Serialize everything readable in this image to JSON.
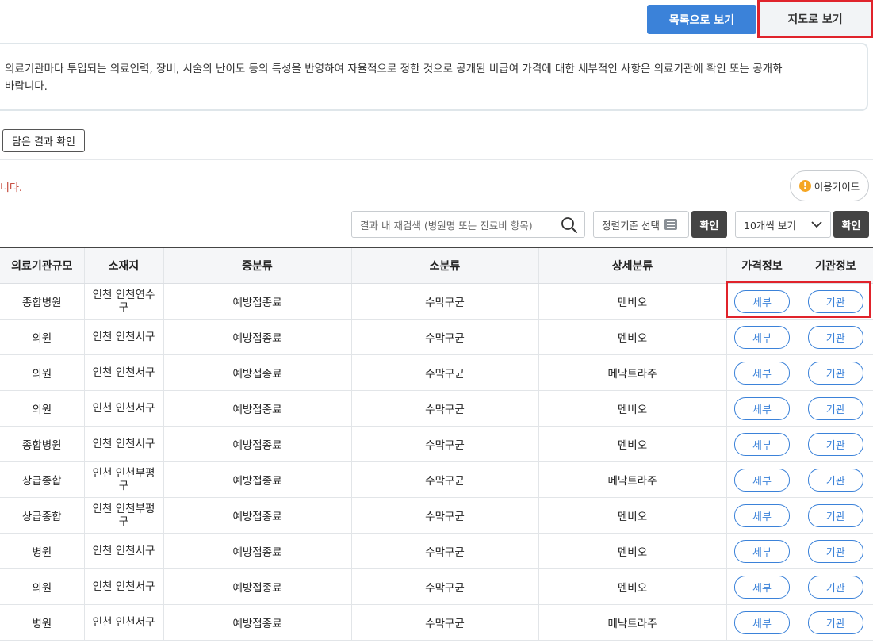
{
  "view_toggle": {
    "list_label": "목록으로 보기",
    "map_label": "지도로 보기"
  },
  "notice": {
    "line1": "의료기관마다 투입되는 의료인력, 장비, 시술의 난이도 등의 특성을 반영하여 자율적으로 정한 것으로 공개된 비급여 가격에 대한 세부적인 사항은 의료기관에 확인 또는 공개화",
    "line2": "바랍니다."
  },
  "cart_button": "담은 결과 확인",
  "red_note": "니다.",
  "guide_button": {
    "icon": "!",
    "label": "이용가이드"
  },
  "search": {
    "placeholder": "결과 내 재검색 (병원명 또는 진료비 항목)",
    "value": ""
  },
  "sort": {
    "label": "정렬기준 선택",
    "confirm": "확인"
  },
  "per_page": {
    "label": "10개씩 보기",
    "confirm": "확인"
  },
  "table": {
    "headers": [
      "의료기관규모",
      "소재지",
      "중분류",
      "소분류",
      "상세분류",
      "가격정보",
      "기관정보"
    ],
    "detail_label": "세부",
    "inst_label": "기관",
    "rows": [
      {
        "size": "종합병원",
        "loc": "인천 인천연수구",
        "mid": "예방접종료",
        "sub": "수막구균",
        "detail": "멘비오"
      },
      {
        "size": "의원",
        "loc": "인천 인천서구",
        "mid": "예방접종료",
        "sub": "수막구균",
        "detail": "멘비오"
      },
      {
        "size": "의원",
        "loc": "인천 인천서구",
        "mid": "예방접종료",
        "sub": "수막구균",
        "detail": "메낙트라주"
      },
      {
        "size": "의원",
        "loc": "인천 인천서구",
        "mid": "예방접종료",
        "sub": "수막구균",
        "detail": "멘비오"
      },
      {
        "size": "종합병원",
        "loc": "인천 인천서구",
        "mid": "예방접종료",
        "sub": "수막구균",
        "detail": "멘비오"
      },
      {
        "size": "상급종합",
        "loc": "인천 인천부평구",
        "mid": "예방접종료",
        "sub": "수막구균",
        "detail": "메낙트라주"
      },
      {
        "size": "상급종합",
        "loc": "인천 인천부평구",
        "mid": "예방접종료",
        "sub": "수막구균",
        "detail": "멘비오"
      },
      {
        "size": "병원",
        "loc": "인천 인천서구",
        "mid": "예방접종료",
        "sub": "수막구균",
        "detail": "멘비오"
      },
      {
        "size": "의원",
        "loc": "인천 인천서구",
        "mid": "예방접종료",
        "sub": "수막구균",
        "detail": "멘비오"
      },
      {
        "size": "병원",
        "loc": "인천 인천서구",
        "mid": "예방접종료",
        "sub": "수막구균",
        "detail": "메낙트라주"
      }
    ]
  },
  "colors": {
    "primary": "#3b82d9",
    "highlight": "#e0232b",
    "dark_button": "#444444"
  }
}
